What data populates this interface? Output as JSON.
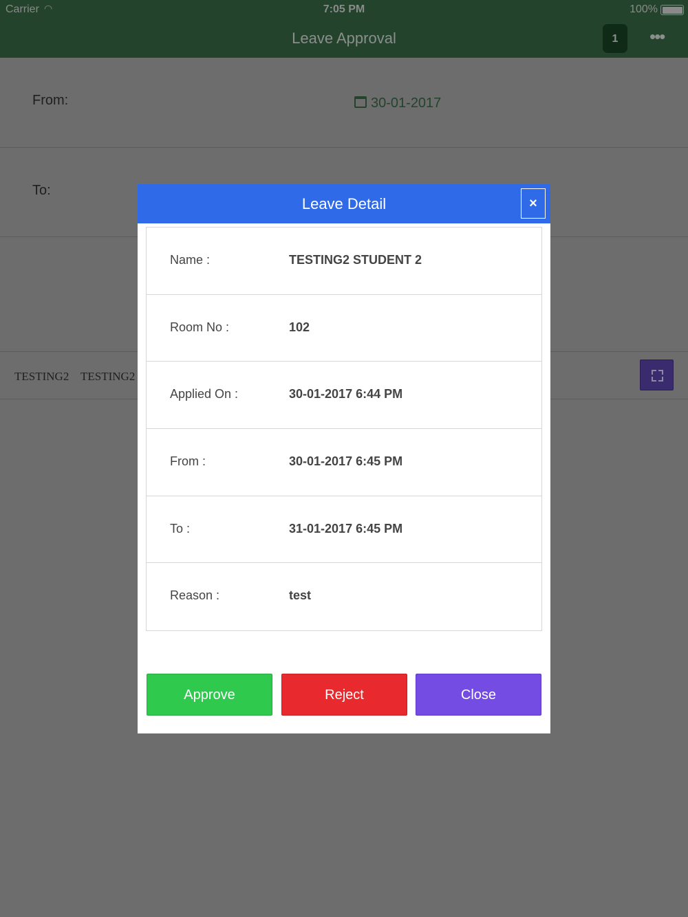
{
  "status_bar": {
    "carrier": "Carrier",
    "time": "7:05 PM",
    "battery": "100%"
  },
  "nav": {
    "title": "Leave Approval",
    "badge_count": "1",
    "more_icon": "•••"
  },
  "filter": {
    "from_label": "From:",
    "from_date": "30-01-2017",
    "to_label": "To:"
  },
  "list": {
    "row": [
      "TESTING2",
      "TESTING2"
    ]
  },
  "modal": {
    "title": "Leave Detail",
    "close_icon": "×",
    "details": [
      {
        "label": "Name :",
        "value": "TESTING2 STUDENT 2"
      },
      {
        "label": "Room No :",
        "value": "102"
      },
      {
        "label": "Applied On :",
        "value": "30-01-2017 6:44 PM"
      },
      {
        "label": "From :",
        "value": "30-01-2017 6:45 PM"
      },
      {
        "label": "To :",
        "value": "31-01-2017 6:45 PM"
      },
      {
        "label": "Reason :",
        "value": "test"
      }
    ],
    "buttons": {
      "approve": "Approve",
      "reject": "Reject",
      "close": "Close"
    }
  },
  "colors": {
    "nav": "#23432c",
    "modal_header": "#2f6ae9",
    "approve": "#2fc94e",
    "reject": "#e8292d",
    "close": "#744be3"
  }
}
